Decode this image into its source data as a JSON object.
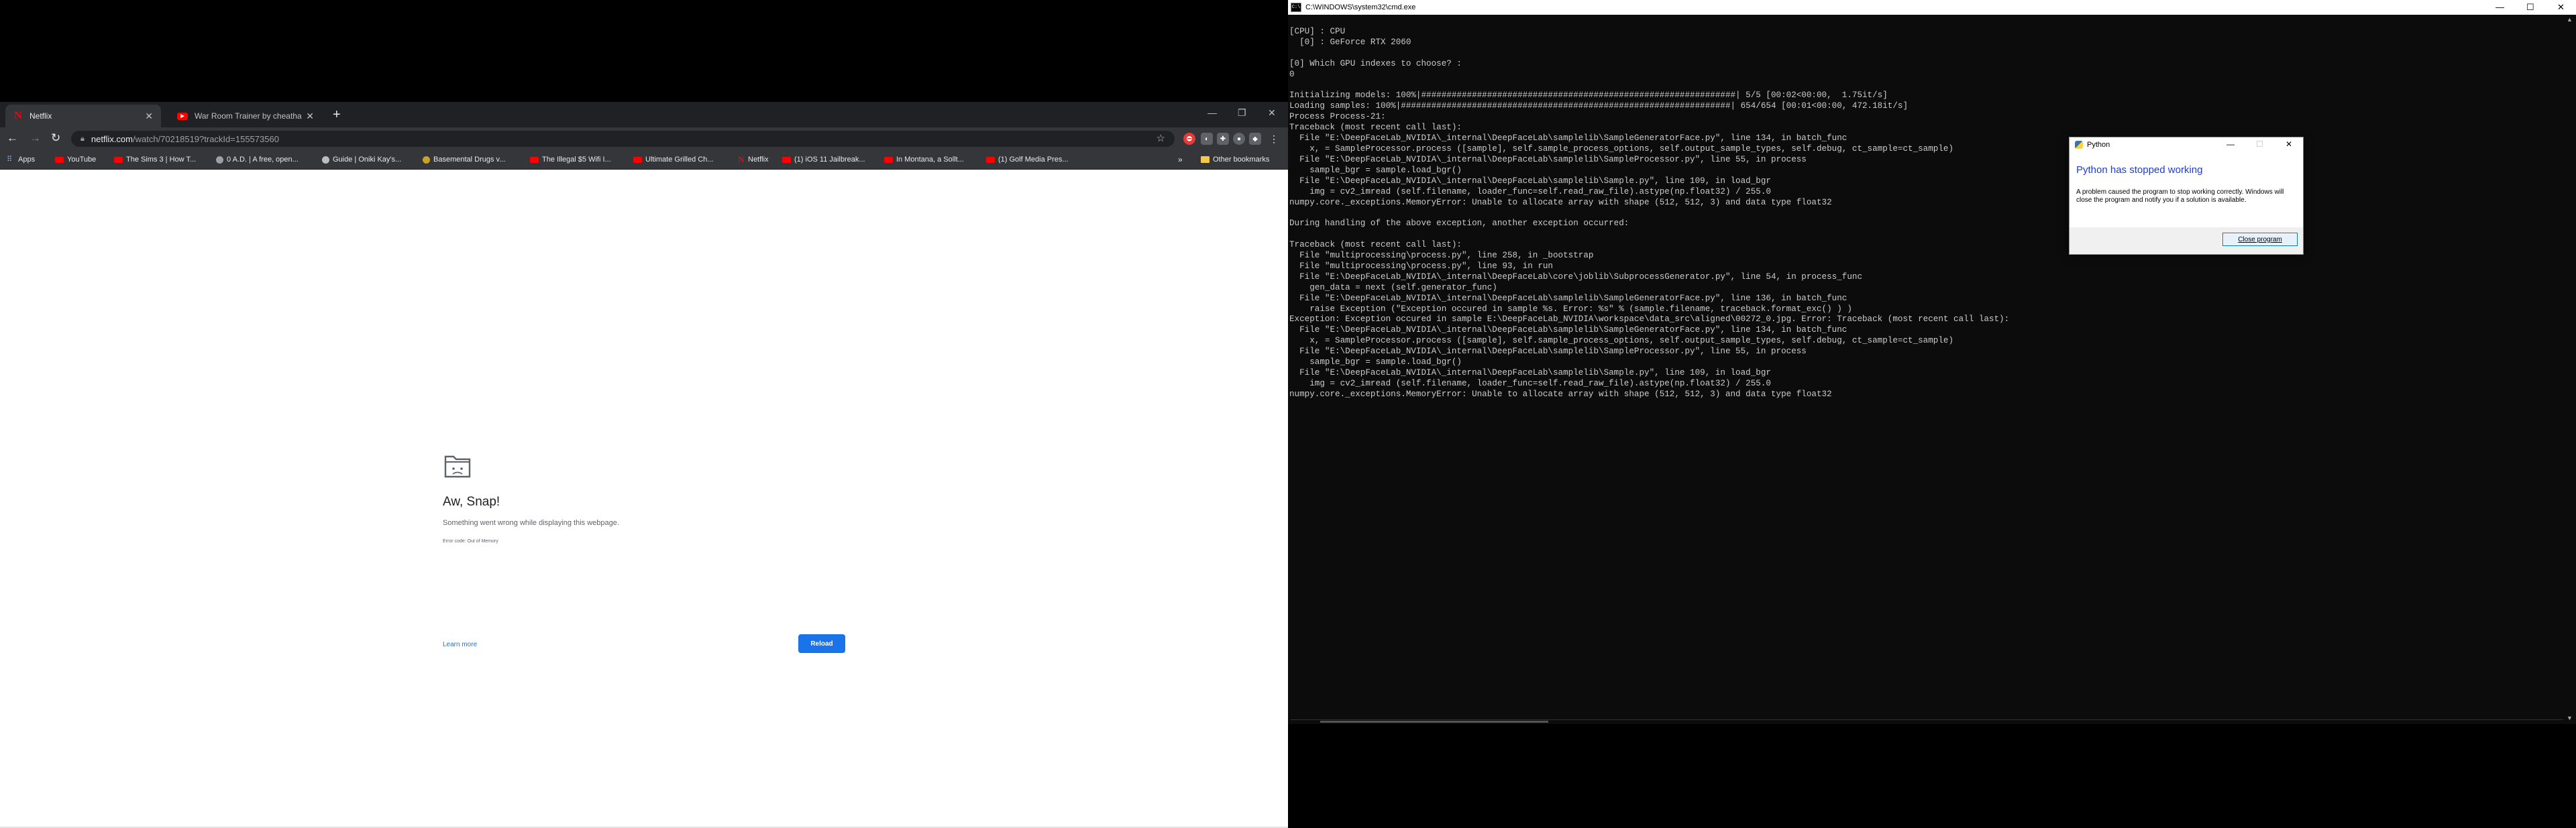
{
  "browser": {
    "tabs": [
      {
        "label": "Netflix",
        "favicon": "netflix-icon",
        "active": true
      },
      {
        "label": "War Room Trainer by cheathapp",
        "favicon": "youtube-icon",
        "active": false
      }
    ],
    "address": {
      "domain": "netflix.com",
      "path": "/watch/70218519?trackId=155573560"
    },
    "bookmarks": [
      {
        "label": "Apps",
        "icon": "apps-grid-icon"
      },
      {
        "label": "YouTube",
        "icon": "youtube-icon"
      },
      {
        "label": "The Sims 3 | How T...",
        "icon": "youtube-icon"
      },
      {
        "label": "0 A.D. | A free, open...",
        "icon": "generic-site-icon"
      },
      {
        "label": "Guide | Oniki Kay's...",
        "icon": "generic-site-icon"
      },
      {
        "label": "Basemental Drugs v...",
        "icon": "generic-site-icon"
      },
      {
        "label": "The Illegal $5 Wifi I...",
        "icon": "youtube-icon"
      },
      {
        "label": "Ultimate Grilled Ch...",
        "icon": "youtube-icon"
      },
      {
        "label": "Netflix",
        "icon": "netflix-icon"
      },
      {
        "label": "(1) iOS 11 Jailbreak...",
        "icon": "youtube-icon"
      },
      {
        "label": "In Montana, a Sollt...",
        "icon": "youtube-icon"
      },
      {
        "label": "(1) Golf Media Pres...",
        "icon": "youtube-icon"
      }
    ],
    "other_bookmarks": "Other bookmarks",
    "error": {
      "title": "Aw, Snap!",
      "message": "Something went wrong while displaying this webpage.",
      "code": "Error code: Out of Memory",
      "learn_more": "Learn more",
      "reload": "Reload"
    }
  },
  "console": {
    "title": "C:\\WINDOWS\\system32\\cmd.exe",
    "output": "[CPU] : CPU\n  [0] : GeForce RTX 2060\n\n[0] Which GPU indexes to choose? :\n0\n\nInitializing models: 100%|##############################################################| 5/5 [00:02<00:00,  1.75it/s]\nLoading samples: 100%|#################################################################| 654/654 [00:01<00:00, 472.18it/s]\nProcess Process-21:\nTraceback (most recent call last):\n  File \"E:\\DeepFaceLab_NVIDIA\\_internal\\DeepFaceLab\\samplelib\\SampleGeneratorFace.py\", line 134, in batch_func\n    x, = SampleProcessor.process ([sample], self.sample_process_options, self.output_sample_types, self.debug, ct_sample=ct_sample)\n  File \"E:\\DeepFaceLab_NVIDIA\\_internal\\DeepFaceLab\\samplelib\\SampleProcessor.py\", line 55, in process\n    sample_bgr = sample.load_bgr()\n  File \"E:\\DeepFaceLab_NVIDIA\\_internal\\DeepFaceLab\\samplelib\\Sample.py\", line 109, in load_bgr\n    img = cv2_imread (self.filename, loader_func=self.read_raw_file).astype(np.float32) / 255.0\nnumpy.core._exceptions.MemoryError: Unable to allocate array with shape (512, 512, 3) and data type float32\n\nDuring handling of the above exception, another exception occurred:\n\nTraceback (most recent call last):\n  File \"multiprocessing\\process.py\", line 258, in _bootstrap\n  File \"multiprocessing\\process.py\", line 93, in run\n  File \"E:\\DeepFaceLab_NVIDIA\\_internal\\DeepFaceLab\\core\\joblib\\SubprocessGenerator.py\", line 54, in process_func\n    gen_data = next (self.generator_func)\n  File \"E:\\DeepFaceLab_NVIDIA\\_internal\\DeepFaceLab\\samplelib\\SampleGeneratorFace.py\", line 136, in batch_func\n    raise Exception (\"Exception occured in sample %s. Error: %s\" % (sample.filename, traceback.format_exc() ) )\nException: Exception occured in sample E:\\DeepFaceLab_NVIDIA\\workspace\\data_src\\aligned\\00272_0.jpg. Error: Traceback (most recent call last):\n  File \"E:\\DeepFaceLab_NVIDIA\\_internal\\DeepFaceLab\\samplelib\\SampleGeneratorFace.py\", line 134, in batch_func\n    x, = SampleProcessor.process ([sample], self.sample_process_options, self.output_sample_types, self.debug, ct_sample=ct_sample)\n  File \"E:\\DeepFaceLab_NVIDIA\\_internal\\DeepFaceLab\\samplelib\\SampleProcessor.py\", line 55, in process\n    sample_bgr = sample.load_bgr()\n  File \"E:\\DeepFaceLab_NVIDIA\\_internal\\DeepFaceLab\\samplelib\\Sample.py\", line 109, in load_bgr\n    img = cv2_imread (self.filename, loader_func=self.read_raw_file).astype(np.float32) / 255.0\nnumpy.core._exceptions.MemoryError: Unable to allocate array with shape (512, 512, 3) and data type float32"
  },
  "dialog": {
    "title": "Python",
    "heading": "Python has stopped working",
    "body": "A problem caused the program to stop working correctly. Windows will close the program and notify you if a solution is available.",
    "close_button": "Close program"
  },
  "colors": {
    "console_bg": "#0c0c0c",
    "chrome_dark": "#35363a",
    "reload_blue": "#1a73e8",
    "dialog_heading": "#1c3bd6",
    "netflix_red": "#e50914"
  }
}
